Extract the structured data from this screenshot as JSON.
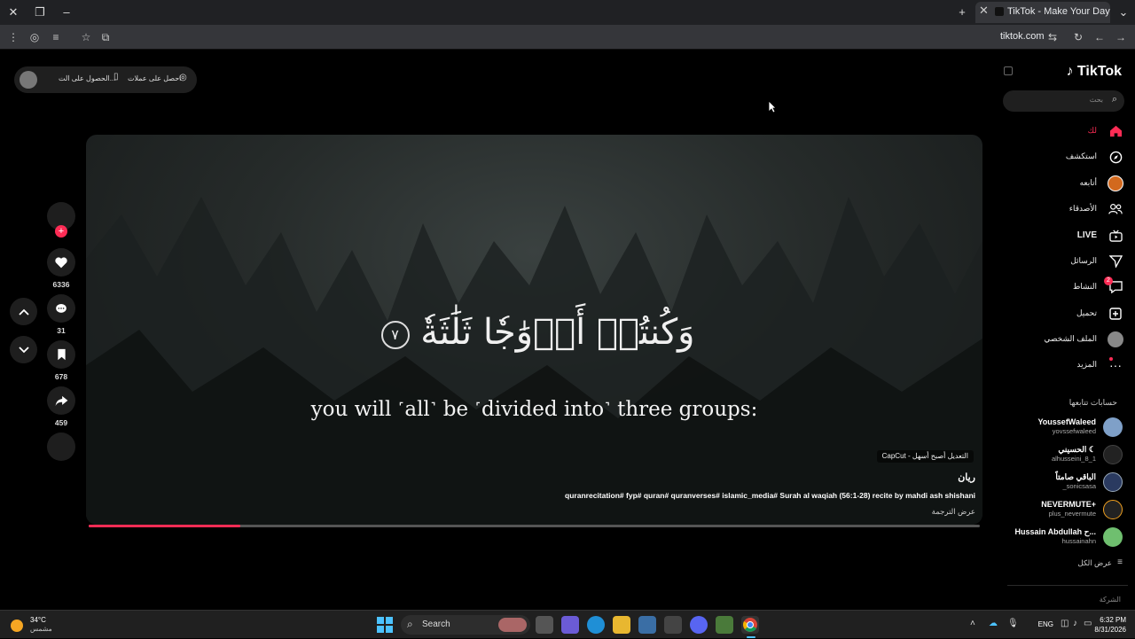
{
  "browser": {
    "tab_title": "TikTok - Make Your Day",
    "url": "tiktok.com"
  },
  "top_pill": {
    "get_coins": "احصل على عملات",
    "get_app": "الحصول على الت..."
  },
  "video": {
    "ayah_text": "وَكُنتُمۡ أَزۡوَٰجٗا ثَلَٰثَةٗ",
    "ayah_number": "٧",
    "translation": "you will ˹all˺ be ˹divided into˺ three groups:",
    "capcut_label": "CapCut - التعديل أصبح أسهل",
    "author": "ريان",
    "caption": "quranrecitation# fyp# quran# quranverses# islamic_media# Surah al waqiah (56:1-28) recite by mahdi ash shishani",
    "see_translation": "عرض الترجمة",
    "progress": 0.17
  },
  "actions": {
    "likes": "6336",
    "comments": "31",
    "saves": "678",
    "shares": "459"
  },
  "sidebar": {
    "logo": "TikTok",
    "search_placeholder": "بحث",
    "nav": [
      {
        "label": "لك",
        "icon": "home-icon",
        "active": true
      },
      {
        "label": "استكشف",
        "icon": "compass-icon"
      },
      {
        "label": "أتابعه",
        "icon": "following-avatar-icon"
      },
      {
        "label": "الأصدقاء",
        "icon": "friends-icon"
      },
      {
        "label": "LIVE",
        "icon": "live-icon"
      },
      {
        "label": "الرسائل",
        "icon": "send-icon"
      },
      {
        "label": "النشاط",
        "icon": "activity-icon",
        "badge": "2"
      },
      {
        "label": "تحميل",
        "icon": "upload-icon"
      },
      {
        "label": "الملف الشخصي",
        "icon": "profile-avatar-icon"
      },
      {
        "label": "المزيد",
        "icon": "more-icon"
      }
    ],
    "following_header": "حسابات تتابعها",
    "accounts": [
      {
        "name": "YoussefWaleed",
        "username": "yovssefwaleed"
      },
      {
        "name": "الحسيني ☾",
        "username": "alhusseini_8_1"
      },
      {
        "name": "الباقي صامتاً",
        "username": "_sonicsasa"
      },
      {
        "name": "NEVERMUTE+",
        "username": "plus_nevermute"
      },
      {
        "name": "Hussain Abdullah ح...",
        "username": "hussainahn"
      }
    ],
    "see_all": "عرض الكل",
    "company": "الشركة"
  },
  "taskbar": {
    "temp": "34°C",
    "condition": "مشمس",
    "search": "Search",
    "lang": "ENG",
    "time": "6:32 PM",
    "date": "8/31/2026"
  },
  "colors": {
    "accent": "#fe2c55",
    "background": "#000000"
  }
}
